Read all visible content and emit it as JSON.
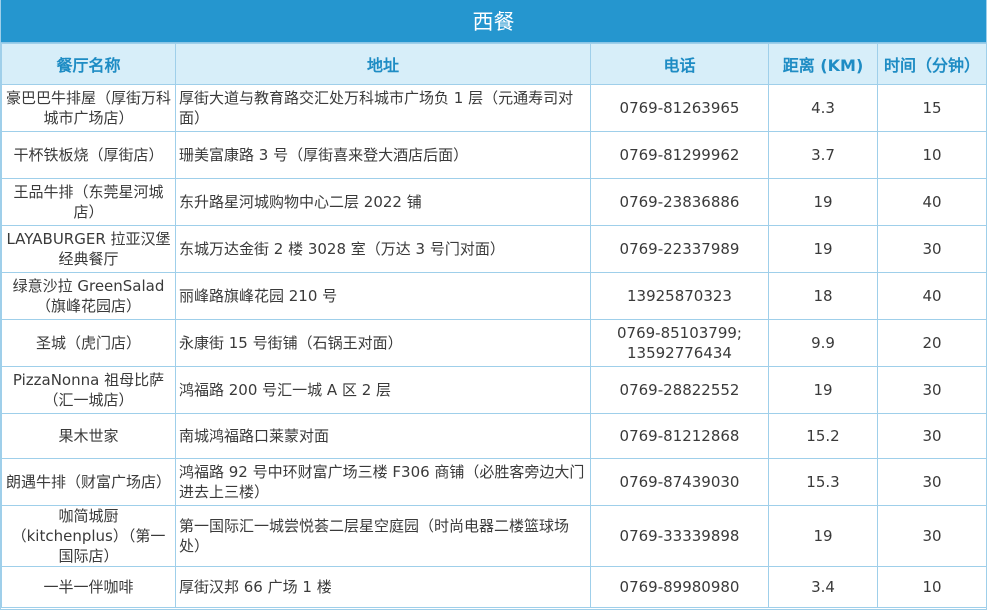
{
  "title": "西餐",
  "columns": [
    "餐厅名称",
    "地址",
    "电话",
    "距离 (KM)",
    "时间（分钟）"
  ],
  "rows": [
    {
      "name": "豪巴巴牛排屋（厚街万科城市广场店）",
      "address": "厚街大道与教育路交汇处万科城市广场负 1 层（元通寿司对面）",
      "phone": [
        "0769-81263965"
      ],
      "distance": "4.3",
      "time": "15"
    },
    {
      "name": "干杯铁板烧（厚街店）",
      "address": "珊美富康路 3 号（厚街喜来登大酒店后面）",
      "phone": [
        "0769-81299962"
      ],
      "distance": "3.7",
      "time": "10"
    },
    {
      "name": "王品牛排（东莞星河城店）",
      "address": "东升路星河城购物中心二层 2022 铺",
      "phone": [
        "0769-23836886"
      ],
      "distance": "19",
      "time": "40"
    },
    {
      "name": "LAYABURGER 拉亚汉堡经典餐厅",
      "address": "东城万达金街 2 楼 3028 室（万达 3 号门对面）",
      "phone": [
        "0769-22337989"
      ],
      "distance": "19",
      "time": "30"
    },
    {
      "name": "绿意沙拉 GreenSalad（旗峰花园店）",
      "address": "丽峰路旗峰花园 210 号",
      "phone": [
        "13925870323"
      ],
      "distance": "18",
      "time": "40"
    },
    {
      "name": "圣城（虎门店）",
      "address": "永康街 15 号街铺（石锅王对面）",
      "phone": [
        "0769-85103799;",
        "13592776434"
      ],
      "distance": "9.9",
      "time": "20"
    },
    {
      "name": "PizzaNonna 祖母比萨（汇一城店）",
      "address": "鸿福路 200 号汇一城 A 区 2 层",
      "phone": [
        "0769-28822552"
      ],
      "distance": "19",
      "time": "30"
    },
    {
      "name": "果木世家",
      "address": "南城鸿福路口莱蒙对面",
      "phone": [
        "0769-81212868"
      ],
      "distance": "15.2",
      "time": "30"
    },
    {
      "name": "朗遇牛排（财富广场店）",
      "address": "鸿福路 92 号中环财富广场三楼 F306 商铺（必胜客旁边大门进去上三楼）",
      "phone": [
        "0769-87439030"
      ],
      "distance": "15.3",
      "time": "30"
    },
    {
      "name": "咖简城厨（kitchenplus）（第一国际店）",
      "address": "第一国际汇一城尝悦荟二层星空庭园（时尚电器二楼篮球场处）",
      "phone": [
        "0769-33339898"
      ],
      "distance": "19",
      "time": "30"
    },
    {
      "name": "一半一伴咖啡",
      "address": "厚街汉邦 66 广场 1 楼",
      "phone": [
        "0769-89980980"
      ],
      "distance": "3.4",
      "time": "10"
    }
  ]
}
